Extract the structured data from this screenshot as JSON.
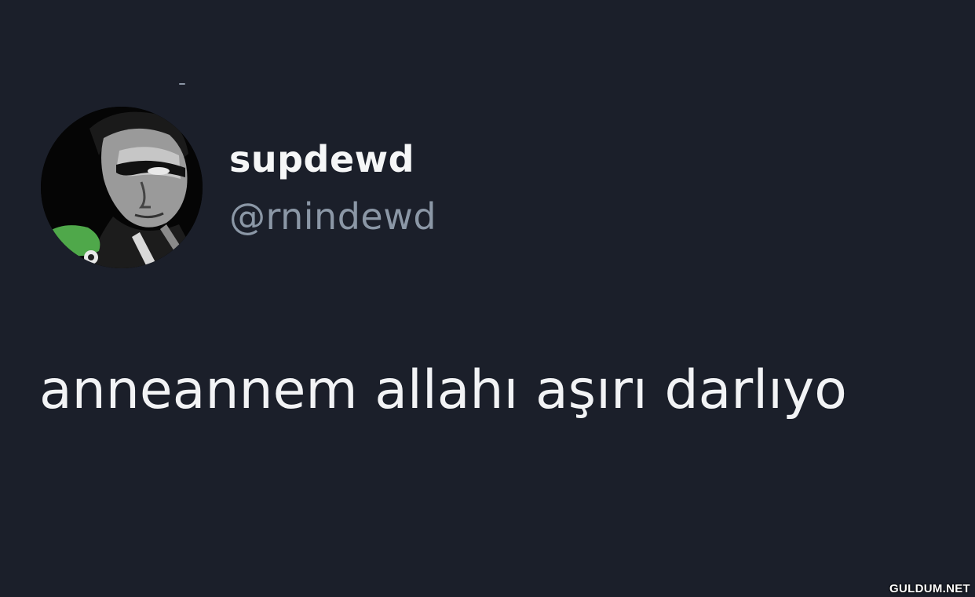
{
  "tweet": {
    "author": {
      "display_name": "supdewd",
      "handle": "@rnindewd",
      "avatar_icon": "profile-photo"
    },
    "text": "anneannem allahı aşırı darlıyo"
  },
  "watermark": "GULDUM.NET",
  "colors": {
    "background": "#1b1f2a",
    "primary_text": "#f2f3f5",
    "secondary_text": "#8b97a6"
  }
}
